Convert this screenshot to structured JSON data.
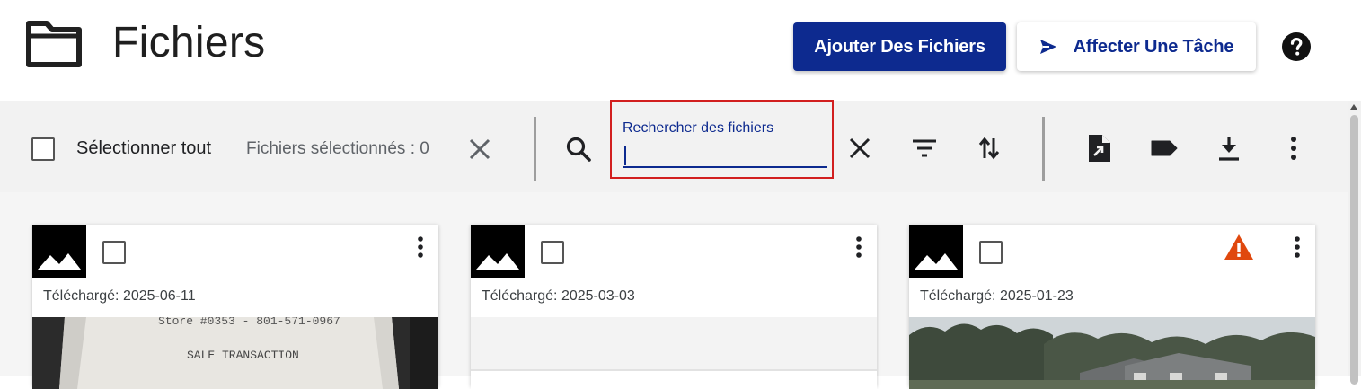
{
  "header": {
    "title": "Fichiers",
    "add_files_label": "Ajouter Des Fichiers",
    "assign_task_label": "Affecter Une Tâche",
    "folder_icon": "folder-icon",
    "help_icon": "help-circle-icon"
  },
  "toolbar": {
    "select_all_label": "Sélectionner tout",
    "selected_count_text": "Fichiers sélectionnés : 0",
    "search_label": "Rechercher des fichiers",
    "search_value": "",
    "icons": [
      "close-icon",
      "search-icon",
      "close-icon",
      "filter-icon",
      "sort-icon",
      "move-file-icon",
      "label-icon",
      "download-icon",
      "more-vert-icon"
    ]
  },
  "cards": [
    {
      "uploaded_text": "Téléchargé: 2025-06-11",
      "warning": false,
      "preview": "receipt-photo",
      "receipt_line1": "Store #0353 - 801-571-0967",
      "receipt_line2": "SALE TRANSACTION"
    },
    {
      "uploaded_text": "Téléchargé: 2025-03-03",
      "warning": false,
      "preview": "blank"
    },
    {
      "uploaded_text": "Téléchargé: 2025-01-23",
      "warning": true,
      "preview": "house-photo"
    }
  ],
  "colors": {
    "primary": "#0d2a8f",
    "highlight": "#d21f1f",
    "warning": "#e0480e",
    "toolbar_bg": "#f2f2f2"
  }
}
